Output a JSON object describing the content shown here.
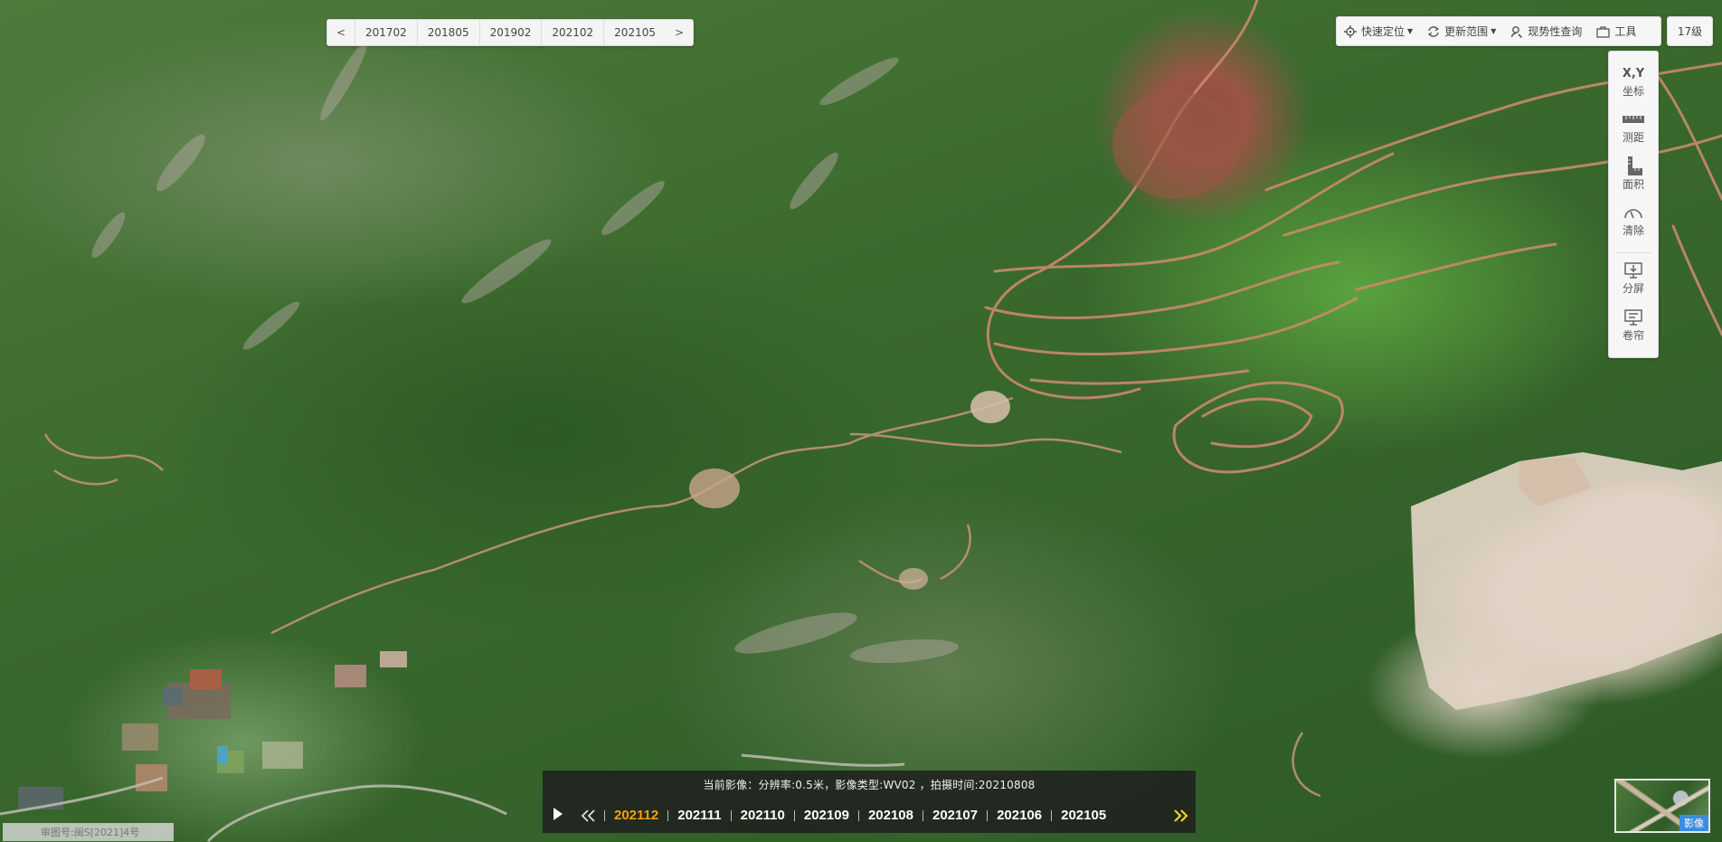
{
  "period_bar": {
    "prev_label": "<",
    "next_label": ">",
    "periods": [
      "201702",
      "201805",
      "201902",
      "202102",
      "202105"
    ]
  },
  "toolbar": {
    "quick_locate": "快速定位",
    "update_range": "更新范围",
    "current_query": "现势性查询",
    "tools": "工具"
  },
  "zoom": {
    "level_label": "17级"
  },
  "side_tools": {
    "coordinate_icon_text": "X,Y",
    "coordinate": "坐标",
    "distance": "测距",
    "area": "面积",
    "clear": "清除",
    "split_screen": "分屏",
    "swipe": "卷帘"
  },
  "timeline": {
    "info": "当前影像：分辨率:0.5米，影像类型:WV02 ，拍摄时间:20210808",
    "active_date": "202112",
    "dates": [
      "202112",
      "202111",
      "202110",
      "202109",
      "202108",
      "202107",
      "202106",
      "202105"
    ]
  },
  "approval": {
    "text": "审图号:闽S[2021]4号"
  },
  "layer_thumb": {
    "label": "影像"
  },
  "colors": {
    "active_date": "#f5a00d",
    "next_arrow": "#f0d21b",
    "timeline_bg": "#1e201e",
    "toolbar_bg": "#f6f6f6"
  },
  "icons": {
    "play": "play-icon",
    "prev": "double-chevron-left-icon",
    "next": "double-chevron-right-icon",
    "locate": "crosshair-icon",
    "update": "refresh-icon",
    "query": "person-search-icon",
    "tools": "toolbox-icon"
  }
}
